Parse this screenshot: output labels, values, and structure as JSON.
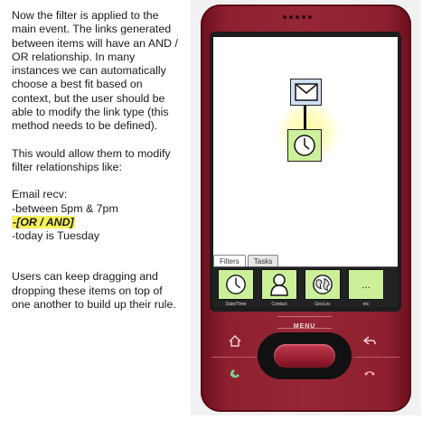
{
  "notes": {
    "p1": "Now the filter is applied to the main event.  The links generated between items will have an AND / OR relationship. In many instances we can automatically choose a best fit based on context, but the user should be able to modify the link type (this method needs to be defined).",
    "p2": "This would allow them to modify filter relationships like:",
    "line1": "Email recv:",
    "line2": "-between 5pm & 7pm",
    "line3": "-[OR / AND]",
    "line4": "-today is Tuesday",
    "p4": "Users can keep dragging and dropping these items on top of one another to build up their rule."
  },
  "phone": {
    "menu_label": "MENU",
    "tabs": [
      "Filters",
      "Tasks"
    ],
    "tray": [
      {
        "label": "Date/Time",
        "icon": "clock-icon"
      },
      {
        "label": "Contact",
        "icon": "person-icon"
      },
      {
        "label": "GeoLoc",
        "icon": "globe-icon"
      },
      {
        "label": "etc",
        "icon": "ellipsis-icon",
        "text": "..."
      }
    ],
    "canvas_nodes": [
      {
        "icon": "mail-icon",
        "color": "#cfe0f5"
      },
      {
        "icon": "clock-icon",
        "color": "#ccf09a"
      }
    ],
    "colors": {
      "body": "#962636",
      "tile": "#ccf09a",
      "highlight": "#f6f05a"
    }
  }
}
